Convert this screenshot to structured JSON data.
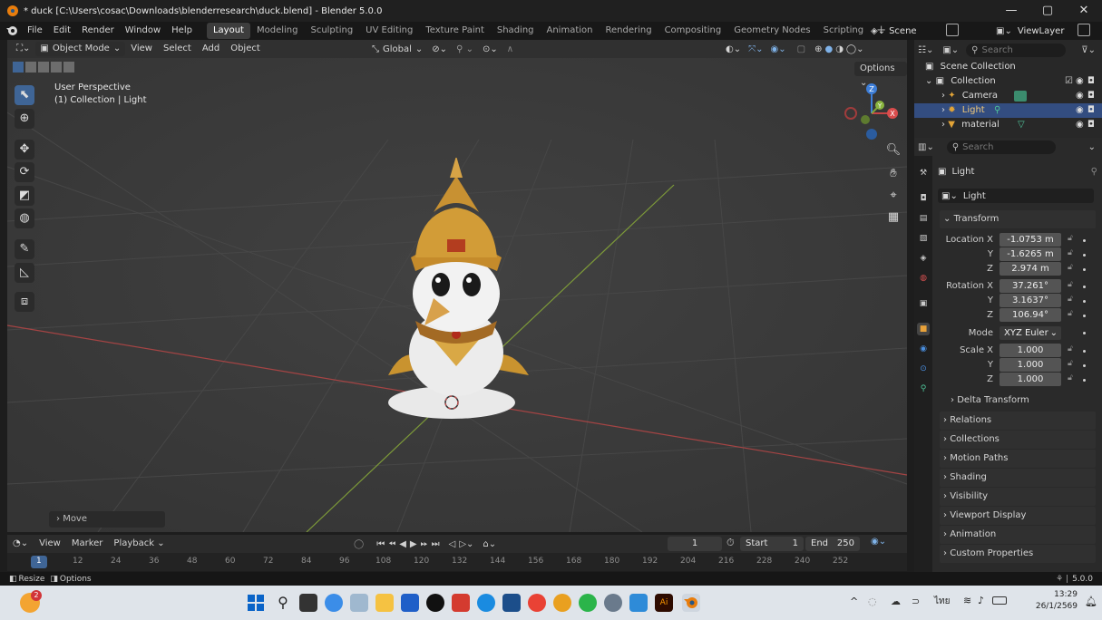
{
  "titlebar": {
    "title": "* duck [C:\\Users\\cosac\\Downloads\\blenderresearch\\duck.blend] - Blender 5.0.0",
    "minimize": "—",
    "maximize": "▢",
    "close": "✕"
  },
  "menu": {
    "items": [
      "File",
      "Edit",
      "Render",
      "Window",
      "Help"
    ],
    "workspaces": [
      "Layout",
      "Modeling",
      "Sculpting",
      "UV Editing",
      "Texture Paint",
      "Shading",
      "Animation",
      "Rendering",
      "Compositing",
      "Geometry Nodes",
      "Scripting"
    ],
    "active_workspace": "Layout",
    "add_workspace": "+",
    "scene": "Scene",
    "viewlayer": "ViewLayer"
  },
  "viewport_header": {
    "mode": "Object Mode",
    "items": [
      "View",
      "Select",
      "Add",
      "Object"
    ],
    "orientation": "Global",
    "options": "Options"
  },
  "viewport": {
    "perspective": "User Perspective",
    "collection_info": "(1) Collection | Light",
    "last_op": "Move",
    "gizmo": {
      "z": "Z",
      "y": "Y",
      "x": "X"
    }
  },
  "timeline": {
    "items": [
      "View",
      "Marker",
      "Playback"
    ],
    "current_frame": "1",
    "start_label": "Start",
    "start": "1",
    "end_label": "End",
    "end": "250",
    "ticks": [
      "1",
      "12",
      "24",
      "36",
      "48",
      "60",
      "72",
      "84",
      "96",
      "108",
      "120",
      "132",
      "144",
      "156",
      "168",
      "180",
      "192",
      "204",
      "216",
      "228",
      "240",
      "252"
    ]
  },
  "status": {
    "resize": "Resize",
    "options": "Options",
    "version": "5.0.0"
  },
  "outliner": {
    "search_placeholder": "Search",
    "scene_collection": "Scene Collection",
    "collection": "Collection",
    "objects": [
      "Camera",
      "Light",
      "material"
    ]
  },
  "properties": {
    "search_placeholder": "Search",
    "object_name": "Light",
    "data_name": "Light",
    "transform_header": "Transform",
    "location_label": "Location X",
    "y_label": "Y",
    "z_label": "Z",
    "location": [
      "-1.0753 m",
      "-1.6265 m",
      "2.974 m"
    ],
    "rotation_label": "Rotation X",
    "rotation": [
      "37.261°",
      "3.1637°",
      "106.94°"
    ],
    "mode_label": "Mode",
    "mode_value": "XYZ Euler",
    "scale_label": "Scale X",
    "scale": [
      "1.000",
      "1.000",
      "1.000"
    ],
    "delta": "Delta Transform",
    "panels": [
      "Relations",
      "Collections",
      "Motion Paths",
      "Shading",
      "Visibility",
      "Viewport Display",
      "Animation",
      "Custom Properties"
    ]
  },
  "taskbar": {
    "notification_count": "2",
    "lang": "ไทย",
    "time": "13:29",
    "date": "26/1/2569"
  }
}
